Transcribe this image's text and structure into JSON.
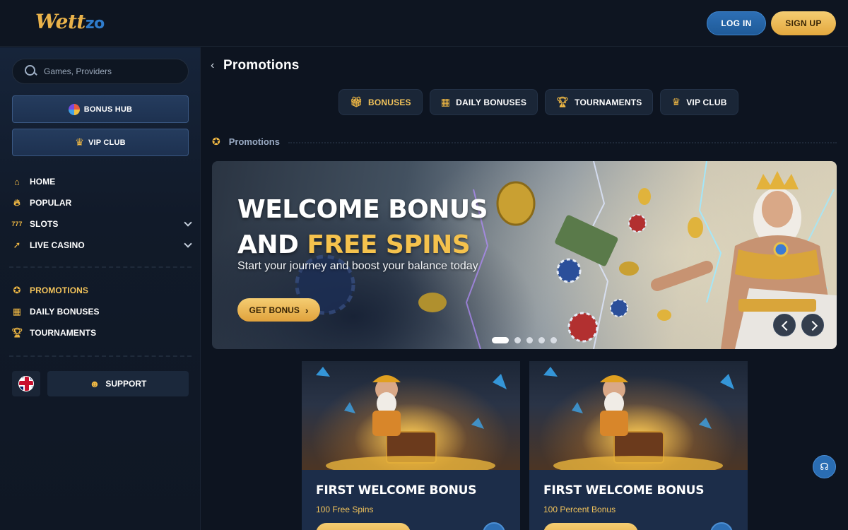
{
  "header": {
    "logo_main": "Wett",
    "logo_accent": "zo",
    "login_label": "LOG IN",
    "signup_label": "SIGN UP"
  },
  "sidebar": {
    "search_placeholder": "Games, Providers",
    "bonus_hub_label": "BONUS HUB",
    "vip_club_label": "VIP CLUB",
    "nav": [
      {
        "label": "HOME",
        "icon": "home-icon"
      },
      {
        "label": "POPULAR",
        "icon": "flame-icon"
      },
      {
        "label": "SLOTS",
        "icon": "slots-icon",
        "expandable": true
      },
      {
        "label": "LIVE CASINO",
        "icon": "rocket-icon",
        "expandable": true
      }
    ],
    "nav2": [
      {
        "label": "PROMOTIONS",
        "icon": "promotions-icon",
        "active": true
      },
      {
        "label": "DAILY BONUSES",
        "icon": "calendar-icon"
      },
      {
        "label": "TOURNAMENTS",
        "icon": "trophy-icon"
      }
    ],
    "language_icon": "uk-flag-icon",
    "support_label": "SUPPORT"
  },
  "main": {
    "page_title": "Promotions",
    "tabs": [
      {
        "label": "BONUSES",
        "icon": "gift-icon",
        "active": true
      },
      {
        "label": "DAILY BONUSES",
        "icon": "calendar-icon"
      },
      {
        "label": "TOURNAMENTS",
        "icon": "trophy-icon"
      },
      {
        "label": "VIP CLUB",
        "icon": "crown-icon"
      }
    ],
    "section_title": "Promotions",
    "banner": {
      "title_line1": "WELCOME BONUS",
      "title_line2_white": "AND ",
      "title_line2_gold": "FREE SPINS",
      "subtitle": "Start your journey and boost your balance today",
      "cta_label": "GET BONUS",
      "slide_count": 5,
      "active_slide": 1
    },
    "cards": [
      {
        "title": "FIRST WELCOME BONUS",
        "subtitle": "100 Free Spins"
      },
      {
        "title": "FIRST WELCOME BONUS",
        "subtitle": "100 Percent Bonus"
      }
    ]
  },
  "colors": {
    "accent_gold": "#f3c45b",
    "accent_blue": "#2d6fb5",
    "background": "#0d1420"
  }
}
